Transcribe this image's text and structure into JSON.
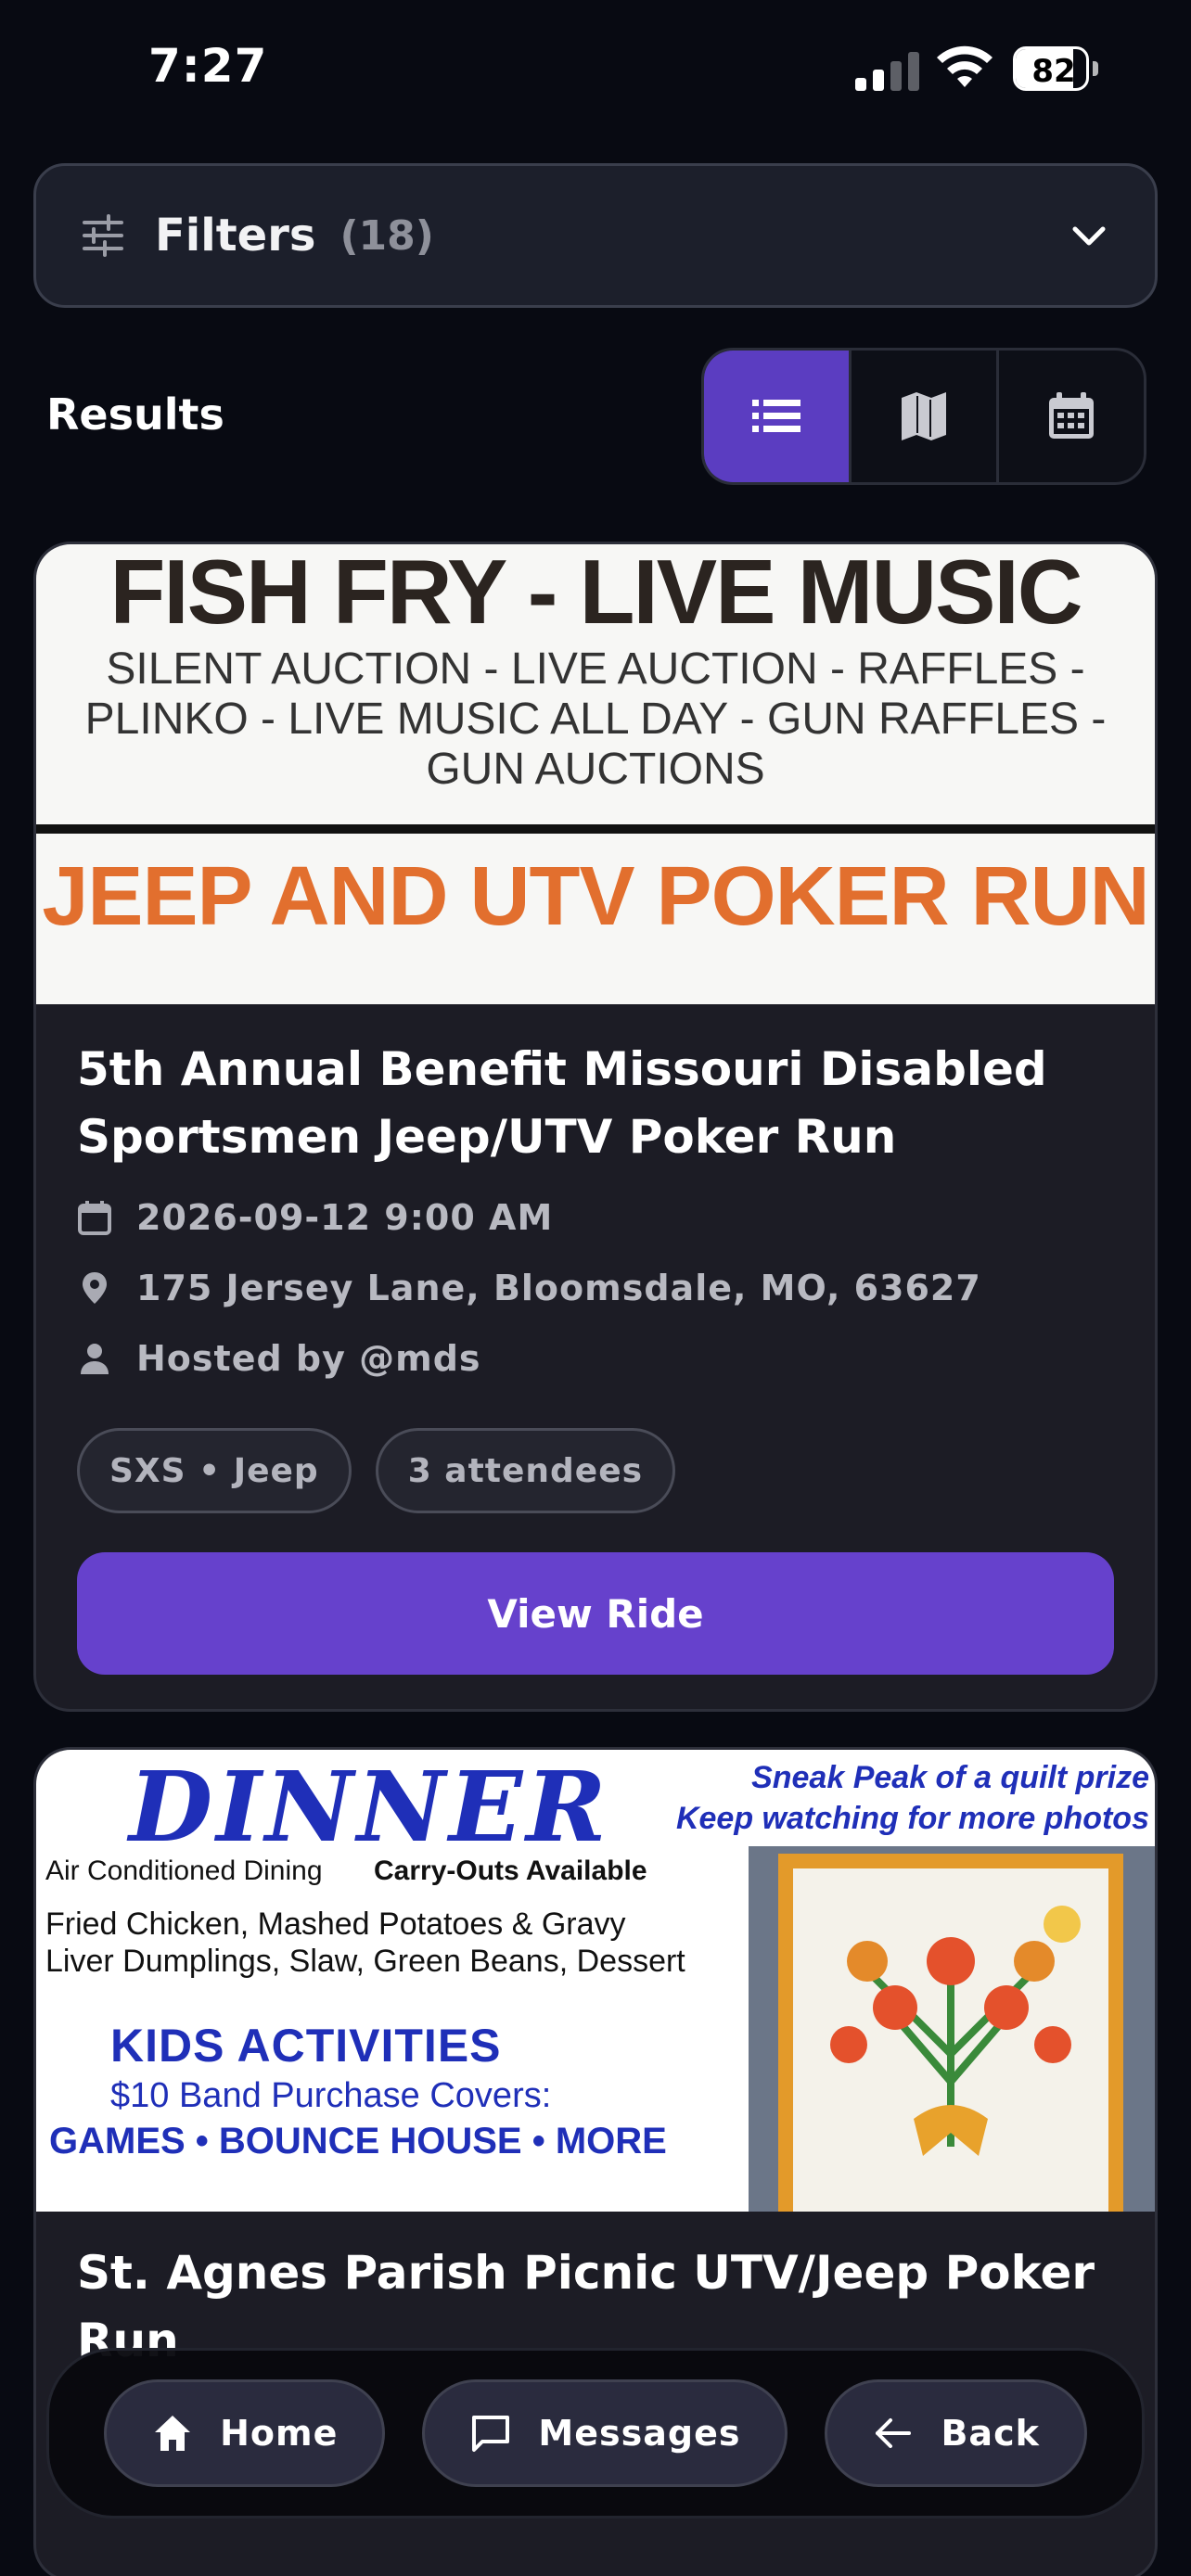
{
  "status_bar": {
    "time": "7:27",
    "battery": "82",
    "battery_level": 0.82
  },
  "filters": {
    "label": "Filters",
    "count": "(18)"
  },
  "results": {
    "label": "Results"
  },
  "view_toggle": {
    "options": [
      "list-icon",
      "map-icon",
      "calendar-icon"
    ],
    "active": "list-icon"
  },
  "cards": [
    {
      "flyer": {
        "title": "FISH FRY - LIVE MUSIC",
        "subtitle": "SILENT AUCTION - LIVE AUCTION - RAFFLES - PLINKO - LIVE MUSIC ALL DAY - GUN RAFFLES - GUN AUCTIONS",
        "headline": "JEEP AND UTV POKER RUN"
      },
      "title": "5th Annual Benefit Missouri Disabled Sportsmen Jeep/UTV Poker Run",
      "datetime": "2026-09-12 9:00 AM",
      "address": "175 Jersey Lane, Bloomsdale, MO, 63627",
      "host": "Hosted by @mds",
      "tags": [
        "SXS • Jeep",
        "3 attendees"
      ],
      "button": "View Ride"
    },
    {
      "flyer": {
        "title": "DINNER",
        "sneak": "Sneak Peak of a quilt prize\nKeep watching for more photos",
        "dining": "Air Conditioned Dining",
        "carryout": "Carry-Outs  Available",
        "menu": "Fried Chicken, Mashed Potatoes & Gravy\nLiver Dumplings, Slaw, Green Beans, Dessert",
        "kids": "KIDS ACTIVITIES",
        "band": "$10 Band Purchase Covers:",
        "games": "GAMES • BOUNCE HOUSE • MORE"
      },
      "title": "St. Agnes Parish Picnic UTV/Jeep Poker Run"
    }
  ],
  "bottom_nav": [
    {
      "label": "Home",
      "icon": "home-icon"
    },
    {
      "label": "Messages",
      "icon": "message-icon"
    },
    {
      "label": "Back",
      "icon": "arrow-left-icon"
    }
  ],
  "colors": {
    "accent": "#5b3dc1",
    "button": "#6641cc",
    "background": "#080a12",
    "card": "#1c1c25"
  }
}
